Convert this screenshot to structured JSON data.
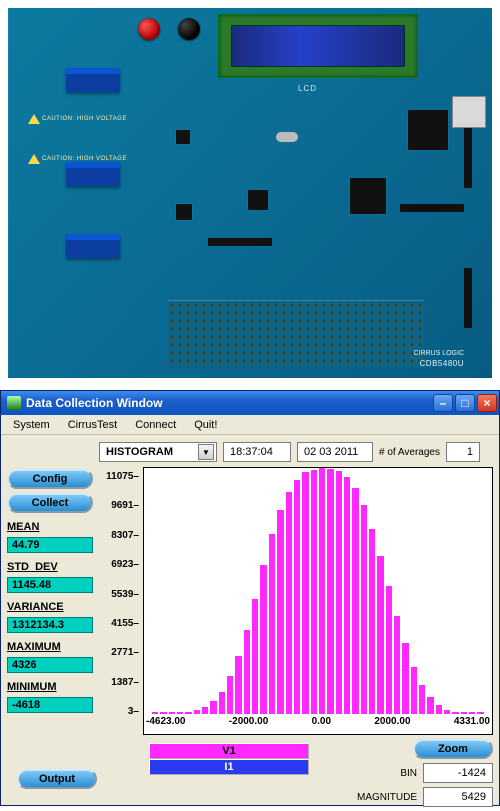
{
  "pcb": {
    "lcd_label": "LCD",
    "caution_text": "CAUTION: HIGH VOLTAGE",
    "brand": "CIRRUS LOGIC",
    "part_number": "CDB5480U"
  },
  "win": {
    "title": "Data Collection Window",
    "menu": {
      "system": "System",
      "cirrustest": "CirrusTest",
      "connect": "Connect",
      "quit": "Quit!"
    },
    "buttons": {
      "minimize": "–",
      "maximize": "□",
      "close": "×"
    }
  },
  "controls": {
    "config": "Config",
    "collect": "Collect",
    "output": "Output",
    "zoom": "Zoom"
  },
  "toolbar": {
    "mode": "HISTOGRAM",
    "time": "18:37:04",
    "date": "02 03 2011",
    "avg_label": "# of Averages",
    "avg_value": "1"
  },
  "stats": {
    "mean_label": "MEAN",
    "mean": "44.79",
    "std_label": "STD_DEV",
    "std": "1145.48",
    "var_label": "VARIANCE",
    "var": "1312134.3",
    "max_label": "MAXIMUM",
    "max": "4326",
    "min_label": "MINIMUM",
    "min": "-4618"
  },
  "channels": {
    "v1": "V1",
    "i1": "I1"
  },
  "readout": {
    "bin_label": "BIN",
    "bin": "-1424",
    "mag_label": "MAGNITUDE",
    "mag": "5429"
  },
  "chart_data": {
    "type": "bar",
    "title": "",
    "xlabel": "",
    "ylabel": "",
    "xlim": [
      -4623.0,
      4331.0
    ],
    "ylim": [
      3,
      11075
    ],
    "xticks": [
      "-4623.00",
      "-2000.00",
      "0.00",
      "2000.00",
      "4331.00"
    ],
    "yticks": [
      "11075",
      "9691",
      "8307",
      "6923",
      "5539",
      "4155",
      "2771",
      "1387",
      "3"
    ],
    "values": [
      5,
      12,
      20,
      40,
      90,
      170,
      320,
      590,
      1000,
      1700,
      2600,
      3800,
      5200,
      6700,
      8100,
      9200,
      10000,
      10550,
      10880,
      11000,
      11075,
      11050,
      10920,
      10650,
      10160,
      9400,
      8350,
      7100,
      5750,
      4400,
      3180,
      2120,
      1320,
      760,
      400,
      200,
      90,
      40,
      18,
      8
    ]
  }
}
